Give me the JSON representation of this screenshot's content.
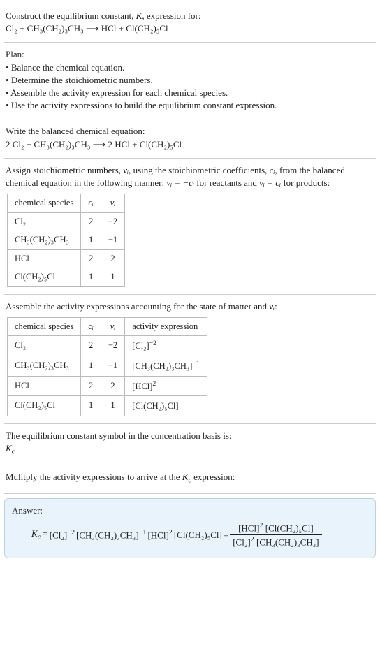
{
  "intro": {
    "line1_prefix": "Construct the equilibrium constant, ",
    "K": "K",
    "line1_suffix": ", expression for:",
    "eq_lhs": "Cl₂ + CH₃(CH₂)₃CH₃",
    "arrow": "⟶",
    "eq_rhs": "HCl + Cl(CH₂)₅Cl"
  },
  "plan": {
    "heading": "Plan:",
    "items": [
      "Balance the chemical equation.",
      "Determine the stoichiometric numbers.",
      "Assemble the activity expression for each chemical species.",
      "Use the activity expressions to build the equilibrium constant expression."
    ]
  },
  "balanced": {
    "heading": "Write the balanced chemical equation:",
    "eq_lhs": "2 Cl₂ + CH₃(CH₂)₃CH₃",
    "arrow": "⟶",
    "eq_rhs": "2 HCl + Cl(CH₂)₅Cl"
  },
  "stoich": {
    "text_part1": "Assign stoichiometric numbers, ",
    "nu_i": "νᵢ",
    "text_part2": ", using the stoichiometric coefficients, ",
    "c_i": "cᵢ",
    "text_part3": ", from the balanced chemical equation in the following manner: ",
    "rel1": "νᵢ = −cᵢ",
    "rel1_suffix": " for reactants and ",
    "rel2": "νᵢ = cᵢ",
    "rel2_suffix": " for products:",
    "headers": [
      "chemical species",
      "cᵢ",
      "νᵢ"
    ],
    "rows": [
      [
        "Cl₂",
        "2",
        "−2"
      ],
      [
        "CH₃(CH₂)₃CH₃",
        "1",
        "−1"
      ],
      [
        "HCl",
        "2",
        "2"
      ],
      [
        "Cl(CH₂)₅Cl",
        "1",
        "1"
      ]
    ]
  },
  "activity": {
    "text_part1": "Assemble the activity expressions accounting for the state of matter and ",
    "nu_i": "νᵢ",
    "text_part2": ":",
    "headers": [
      "chemical species",
      "cᵢ",
      "νᵢ",
      "activity expression"
    ],
    "rows": [
      {
        "sp": "Cl₂",
        "c": "2",
        "nu": "−2",
        "expr_base": "[Cl₂]",
        "expr_exp": "−2"
      },
      {
        "sp": "CH₃(CH₂)₃CH₃",
        "c": "1",
        "nu": "−1",
        "expr_base": "[CH₃(CH₂)₃CH₃]",
        "expr_exp": "−1"
      },
      {
        "sp": "HCl",
        "c": "2",
        "nu": "2",
        "expr_base": "[HCl]",
        "expr_exp": "2"
      },
      {
        "sp": "Cl(CH₂)₅Cl",
        "c": "1",
        "nu": "1",
        "expr_base": "[Cl(CH₂)₅Cl]",
        "expr_exp": ""
      }
    ]
  },
  "kc_symbol": {
    "text": "The equilibrium constant symbol in the concentration basis is:",
    "symbol_K": "K",
    "symbol_c": "c"
  },
  "mult_line": {
    "text_prefix": "Mulitply the activity expressions to arrive at the ",
    "K": "K",
    "c": "c",
    "text_suffix": " expression:"
  },
  "answer": {
    "label": "Answer:",
    "K": "K",
    "c": "c",
    "eq": " = ",
    "t1_base": "[Cl₂]",
    "t1_exp": "−2",
    "t2_base": "[CH₃(CH₂)₃CH₃]",
    "t2_exp": "−1",
    "t3_base": "[HCl]",
    "t3_exp": "2",
    "t4_base": "[Cl(CH₂)₅Cl]",
    "eq2": " = ",
    "num_t1_base": "[HCl]",
    "num_t1_exp": "2",
    "num_t2_base": "[Cl(CH₂)₅Cl]",
    "den_t1_base": "[Cl₂]",
    "den_t1_exp": "2",
    "den_t2_base": "[CH₃(CH₂)₃CH₃]"
  }
}
